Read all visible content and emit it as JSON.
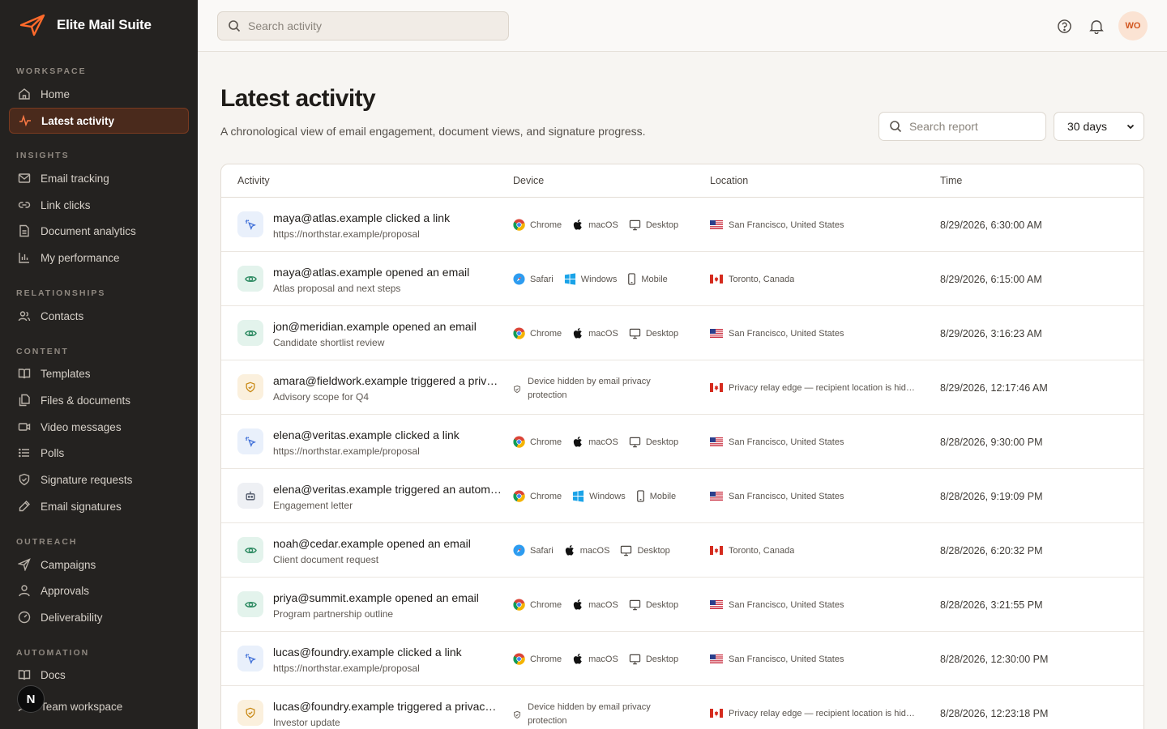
{
  "app": {
    "name": "Elite Mail Suite"
  },
  "sidebar": {
    "sections": {
      "workspace": "WORKSPACE",
      "insights": "INSIGHTS",
      "relationships": "RELATIONSHIPS",
      "content": "CONTENT",
      "outreach": "OUTREACH",
      "automation": "AUTOMATION"
    },
    "items": {
      "home": "Home",
      "latest_activity": "Latest activity",
      "email_tracking": "Email tracking",
      "link_clicks": "Link clicks",
      "document_analytics": "Document analytics",
      "my_performance": "My performance",
      "contacts": "Contacts",
      "templates": "Templates",
      "files_documents": "Files & documents",
      "video_messages": "Video messages",
      "polls": "Polls",
      "signature_requests": "Signature requests",
      "email_signatures": "Email signatures",
      "campaigns": "Campaigns",
      "approvals": "Approvals",
      "deliverability": "Deliverability",
      "docs": "Docs",
      "team_workspace": "Team workspace"
    },
    "badge": "N"
  },
  "topbar": {
    "search_placeholder": "Search activity",
    "avatar_initials": "WO"
  },
  "page": {
    "title": "Latest activity",
    "subtitle": "A chronological view of email engagement, document views, and signature progress.",
    "report_search_placeholder": "Search report",
    "range": "30 days"
  },
  "table": {
    "headers": {
      "activity": "Activity",
      "device": "Device",
      "location": "Location",
      "time": "Time"
    },
    "rows": [
      {
        "type": "click",
        "title": "maya@atlas.example clicked a link",
        "subtitle": "https://northstar.example/proposal",
        "browser": "Chrome",
        "os": "macOS",
        "form": "Desktop",
        "flag": "us",
        "location": "San Francisco, United States",
        "time": "8/29/2026, 6:30:00 AM"
      },
      {
        "type": "open",
        "title": "maya@atlas.example opened an email",
        "subtitle": "Atlas proposal and next steps",
        "browser": "Safari",
        "os": "Windows",
        "form": "Mobile",
        "flag": "ca",
        "location": "Toronto, Canada",
        "time": "8/29/2026, 6:15:00 AM"
      },
      {
        "type": "open",
        "title": "jon@meridian.example opened an email",
        "subtitle": "Candidate shortlist review",
        "browser": "Chrome",
        "os": "macOS",
        "form": "Desktop",
        "flag": "us",
        "location": "San Francisco, United States",
        "time": "8/29/2026, 3:16:23 AM"
      },
      {
        "type": "privacy",
        "title": "amara@fieldwork.example triggered a privacy relay",
        "subtitle": "Advisory scope for Q4",
        "hidden": "Device hidden by email privacy protection",
        "flag": "ca",
        "location": "Privacy relay edge — recipient location is hidden",
        "time": "8/29/2026, 12:17:46 AM"
      },
      {
        "type": "click",
        "title": "elena@veritas.example clicked a link",
        "subtitle": "https://northstar.example/proposal",
        "browser": "Chrome",
        "os": "macOS",
        "form": "Desktop",
        "flag": "us",
        "location": "San Francisco, United States",
        "time": "8/28/2026, 9:30:00 PM"
      },
      {
        "type": "auto",
        "title": "elena@veritas.example triggered an automated open",
        "subtitle": "Engagement letter",
        "browser": "Chrome",
        "os": "Windows",
        "form": "Mobile",
        "flag": "us",
        "location": "San Francisco, United States",
        "time": "8/28/2026, 9:19:09 PM"
      },
      {
        "type": "open",
        "title": "noah@cedar.example opened an email",
        "subtitle": "Client document request",
        "browser": "Safari",
        "os": "macOS",
        "form": "Desktop",
        "flag": "ca",
        "location": "Toronto, Canada",
        "time": "8/28/2026, 6:20:32 PM"
      },
      {
        "type": "open",
        "title": "priya@summit.example opened an email",
        "subtitle": "Program partnership outline",
        "browser": "Chrome",
        "os": "macOS",
        "form": "Desktop",
        "flag": "us",
        "location": "San Francisco, United States",
        "time": "8/28/2026, 3:21:55 PM"
      },
      {
        "type": "click",
        "title": "lucas@foundry.example clicked a link",
        "subtitle": "https://northstar.example/proposal",
        "browser": "Chrome",
        "os": "macOS",
        "form": "Desktop",
        "flag": "us",
        "location": "San Francisco, United States",
        "time": "8/28/2026, 12:30:00 PM"
      },
      {
        "type": "privacy",
        "title": "lucas@foundry.example triggered a privacy relay",
        "subtitle": "Investor update",
        "hidden": "Device hidden by email privacy protection",
        "flag": "ca",
        "location": "Privacy relay edge — recipient location is hidden",
        "time": "8/28/2026, 12:23:18 PM"
      }
    ]
  },
  "colors": {
    "accent": "#ff6a2b",
    "sidebar_bg": "#242220",
    "page_bg": "#f7f5f2"
  }
}
